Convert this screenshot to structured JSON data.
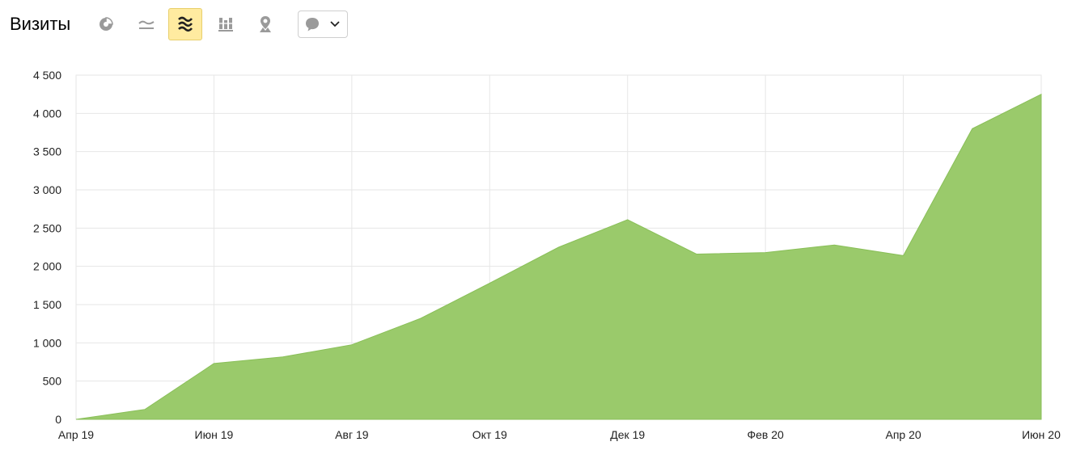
{
  "header": {
    "title": "Визиты",
    "chart_type_buttons": [
      {
        "icon": "pie-chart-icon",
        "active": false
      },
      {
        "icon": "line-chart-icon",
        "active": false
      },
      {
        "icon": "area-chart-icon",
        "active": true
      },
      {
        "icon": "stacked-bar-chart-icon",
        "active": false
      },
      {
        "icon": "map-pin-icon",
        "active": false
      }
    ],
    "annotations_dropdown": {
      "icon": "comment-icon",
      "chevron": "chevron-down-icon"
    }
  },
  "colors": {
    "area": "#9aca6b",
    "area_edge": "#89bf58",
    "grid": "#e6e6e6",
    "active_button": "#ffeba0"
  },
  "chart_data": {
    "type": "area",
    "x": [
      "2019-04",
      "2019-05",
      "2019-06",
      "2019-07",
      "2019-08",
      "2019-09",
      "2019-10",
      "2019-11",
      "2019-12",
      "2020-01",
      "2020-02",
      "2020-03",
      "2020-04",
      "2020-05",
      "2020-06"
    ],
    "series": [
      {
        "values": [
          0,
          130,
          730,
          815,
          975,
          1320,
          1780,
          2250,
          2610,
          2160,
          2180,
          2280,
          2140,
          3800,
          4250
        ]
      }
    ],
    "x_tick_labels": [
      "Апр 19",
      "Июн 19",
      "Авг 19",
      "Окт 19",
      "Дек 19",
      "Фев 20",
      "Апр 20",
      "Июн 20"
    ],
    "y_tick_labels": [
      "0",
      "500",
      "1 000",
      "1 500",
      "2 000",
      "2 500",
      "3 000",
      "3 500",
      "4 000",
      "4 500"
    ],
    "ylim": [
      0,
      4500
    ],
    "grid": true,
    "legend": "none",
    "title": "",
    "xlabel": "",
    "ylabel": ""
  }
}
